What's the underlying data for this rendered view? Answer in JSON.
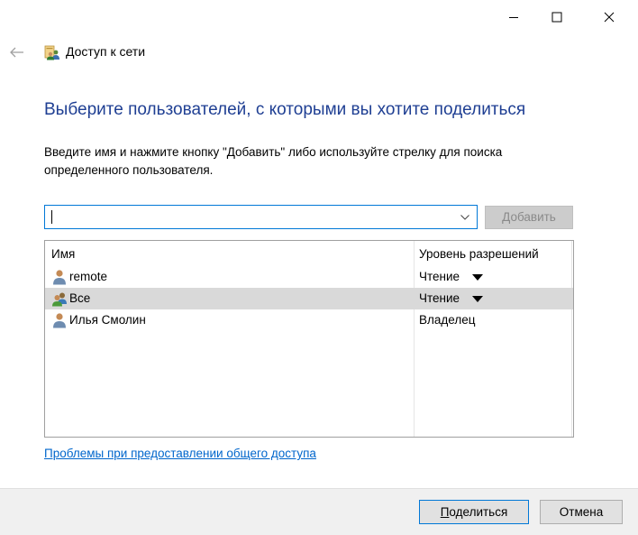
{
  "window": {
    "controls": {
      "minimize_icon": "minimize-icon",
      "maximize_icon": "maximize-icon",
      "close_icon": "close-icon"
    }
  },
  "nav": {
    "title": "Доступ к сети"
  },
  "heading": "Выберите пользователей, с которыми вы хотите поделиться",
  "instructions": {
    "line1": "Введите имя и нажмите кнопку \"Добавить\" либо используйте стрелку для поиска",
    "line2": "определенного пользователя."
  },
  "user_input": {
    "value": "",
    "placeholder": ""
  },
  "add_button": {
    "underlined": "Д",
    "rest": "обавить",
    "disabled": true
  },
  "list": {
    "columns": {
      "name": "Имя",
      "permission": "Уровень разрешений"
    },
    "rows": [
      {
        "name": "remote",
        "permission": "Чтение",
        "has_dropdown": true,
        "icon": "user-icon",
        "selected": false
      },
      {
        "name": "Все",
        "permission": "Чтение",
        "has_dropdown": true,
        "icon": "group-icon",
        "selected": true
      },
      {
        "name": "Илья Смолин",
        "permission": "Владелец",
        "has_dropdown": false,
        "icon": "user-icon",
        "selected": false
      }
    ]
  },
  "help_link": "Проблемы при предоставлении общего доступа",
  "footer": {
    "share_button": {
      "underlined": "П",
      "rest": "оделиться"
    },
    "cancel_button": "Отмена"
  },
  "colors": {
    "heading": "#1f3f93",
    "link": "#0066cc",
    "focus_border": "#0078d7",
    "selected_row": "#d9d9d9",
    "footer_bg": "#f0f0f0"
  }
}
